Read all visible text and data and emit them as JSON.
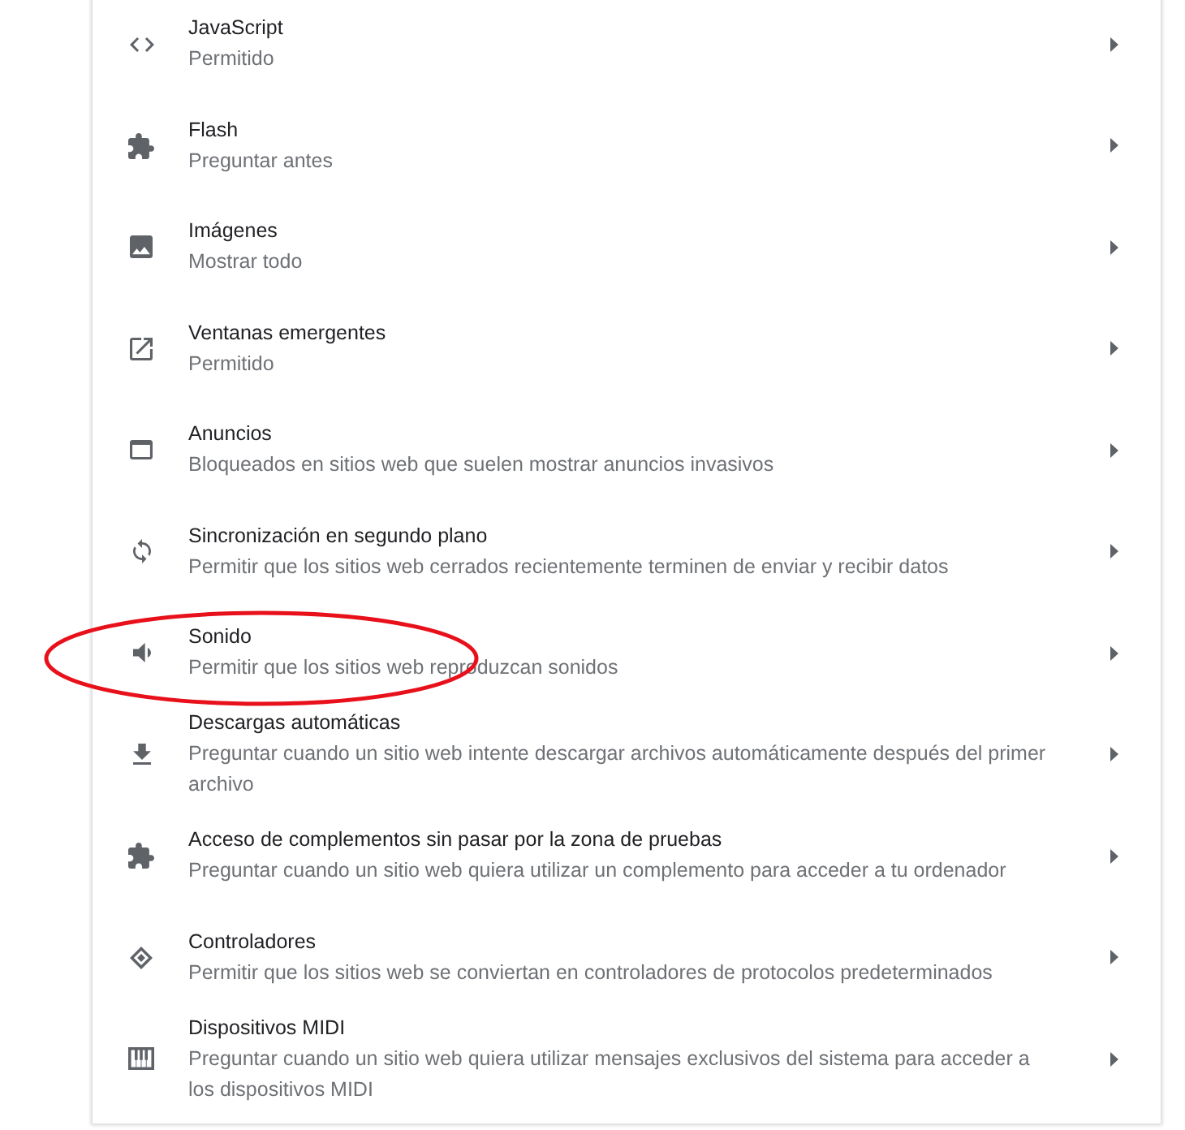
{
  "settings_list": {
    "items": [
      {
        "title": "JavaScript",
        "description": "Permitido",
        "highlighted": false
      },
      {
        "title": "Flash",
        "description": "Preguntar antes",
        "highlighted": false
      },
      {
        "title": "Imágenes",
        "description": "Mostrar todo",
        "highlighted": false
      },
      {
        "title": "Ventanas emergentes",
        "description": "Permitido",
        "highlighted": false
      },
      {
        "title": "Anuncios",
        "description": "Bloqueados en sitios web que suelen mostrar anuncios invasivos",
        "highlighted": false
      },
      {
        "title": "Sincronización en segundo plano",
        "description": "Permitir que los sitios web cerrados recientemente terminen de enviar y recibir datos",
        "highlighted": false
      },
      {
        "title": "Sonido",
        "description": "Permitir que los sitios web reproduzcan sonidos",
        "highlighted": true
      },
      {
        "title": "Descargas automáticas",
        "description": "Preguntar cuando un sitio web intente descargar archivos automáticamente después del primer archivo",
        "highlighted": false
      },
      {
        "title": "Acceso de complementos sin pasar por la zona de pruebas",
        "description": "Preguntar cuando un sitio web quiera utilizar un complemento para acceder a tu ordenador",
        "highlighted": false
      },
      {
        "title": "Controladores",
        "description": "Permitir que los sitios web se conviertan en controladores de protocolos predeterminados",
        "highlighted": false
      },
      {
        "title": "Dispositivos MIDI",
        "description": "Preguntar cuando un sitio web quiera utilizar mensajes exclusivos del sistema para acceder a los dispositivos MIDI",
        "highlighted": false
      }
    ]
  }
}
